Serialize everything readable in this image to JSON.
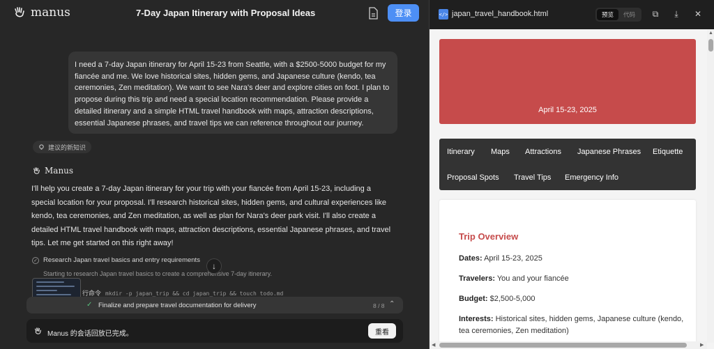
{
  "app": {
    "logo_text": "manus",
    "chat_title": "7-Day Japan Itinerary with Proposal Ideas",
    "login_label": "登录"
  },
  "user_message": "I need a 7-day Japan itinerary for April 15-23 from Seattle, with a $2500-5000 budget for my fiancée and me. We love historical sites, hidden gems, and Japanese culture (kendo, tea ceremonies, Zen meditation). We want to see Nara's deer and explore cities on foot. I plan to propose during this trip and need a special location recommendation. Please provide a detailed itinerary and a simple HTML travel handbook with maps, attraction descriptions, essential Japanese phrases, and travel tips we can reference throughout our journey.",
  "knowledge_chip": "建议的新知识",
  "agent": {
    "name": "Manus",
    "reply": "I'll help you create a 7-day Japan itinerary for your trip with your fiancée from April 15-23, including a special location for your proposal. I'll research historical sites, hidden gems, and cultural experiences like kendo, tea ceremonies, and Zen meditation, as well as plan for Nara's deer park visit. I'll also create a detailed HTML travel handbook with maps, attraction descriptions, essential Japanese phrases, and travel tips. Let me get started on this right away!"
  },
  "task": {
    "title": "Research Japan travel basics and entry requirements",
    "subtitle": "Starting to research Japan travel basics to create a comprehensive 7-day itinerary.",
    "command_label": "行命令",
    "command": "mkdir -p japan_trip && cd japan_trip && touch todo.md"
  },
  "progress": {
    "label": "Finalize and prepare travel documentation for delivery",
    "count": "8 / 8"
  },
  "replay": {
    "message": "Manus 的会话回放已完成。",
    "button": "重看"
  },
  "viewer": {
    "file_name": "japan_travel_handbook.html",
    "tab_preview": "预览",
    "tab_code": "代码",
    "hero_date": "April 15-23, 2025",
    "nav": [
      "Itinerary",
      "Maps",
      "Attractions",
      "Japanese Phrases",
      "Etiquette",
      "Proposal Spots",
      "Travel Tips",
      "Emergency Info"
    ],
    "overview": {
      "title": "Trip Overview",
      "dates_label": "Dates:",
      "dates_value": "April 15-23, 2025",
      "travelers_label": "Travelers:",
      "travelers_value": "You and your fiancée",
      "budget_label": "Budget:",
      "budget_value": "$2,500-5,000",
      "interests_label": "Interests:",
      "interests_value": "Historical sites, hidden gems, Japanese culture (kendo, tea ceremonies, Zen meditation)"
    }
  },
  "colors": {
    "accent": "#4d8ff5",
    "hero": "#c64b4b",
    "nav_bg": "#333333",
    "success": "#58c27d"
  }
}
